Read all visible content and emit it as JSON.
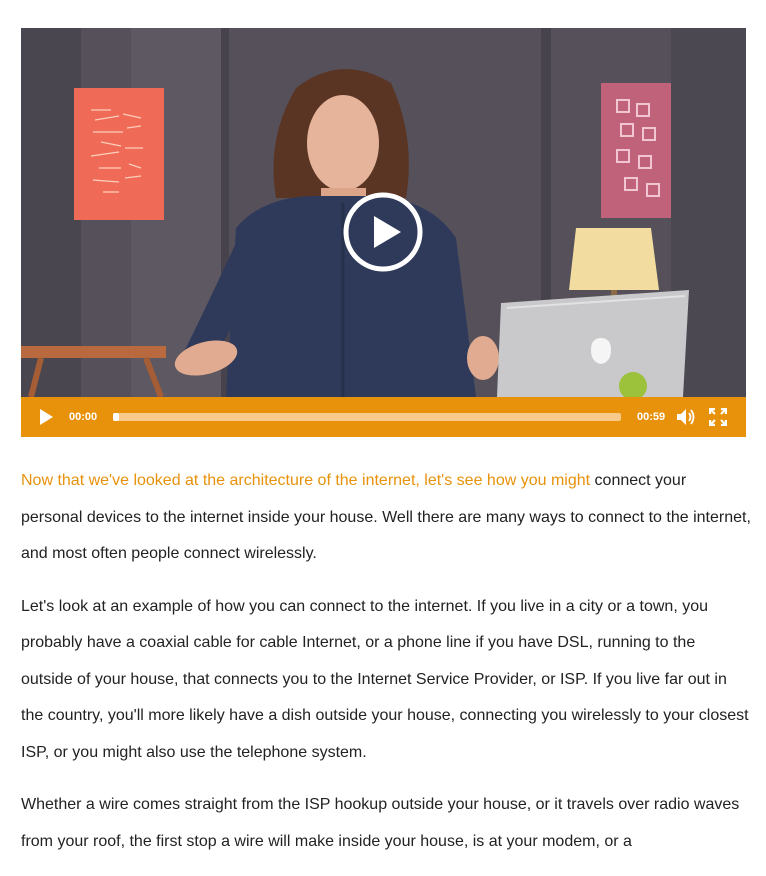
{
  "video": {
    "current_time": "00:00",
    "duration": "00:59",
    "progress": 0.01,
    "accent_color": "#e8920b",
    "icons": {
      "big_play": "play-circle-icon",
      "play": "play-icon",
      "volume": "volume-icon",
      "fullscreen": "fullscreen-icon"
    }
  },
  "transcript": {
    "p1_highlight": "Now that we've looked at the architecture of the internet, let's see how you might",
    "p1_rest": " connect your personal devices to the internet inside your house. Well there are many ways to connect to the internet, and most often people connect wirelessly.",
    "p2": "Let's look at an example of how you can connect to the internet. If you live in a city or a town, you probably have a coaxial cable for cable Internet, or a phone line if you have DSL, running to the outside of your house, that connects you to the Internet Service Provider, or ISP. If you live far out in the country, you'll more likely have a dish outside your house, connecting you wirelessly to your closest ISP, or you might also use the telephone system.",
    "p3": "Whether a wire comes straight from the ISP hookup outside your house, or it travels over radio waves from your roof, the first stop a wire will make inside your house, is at your modem, or a"
  }
}
